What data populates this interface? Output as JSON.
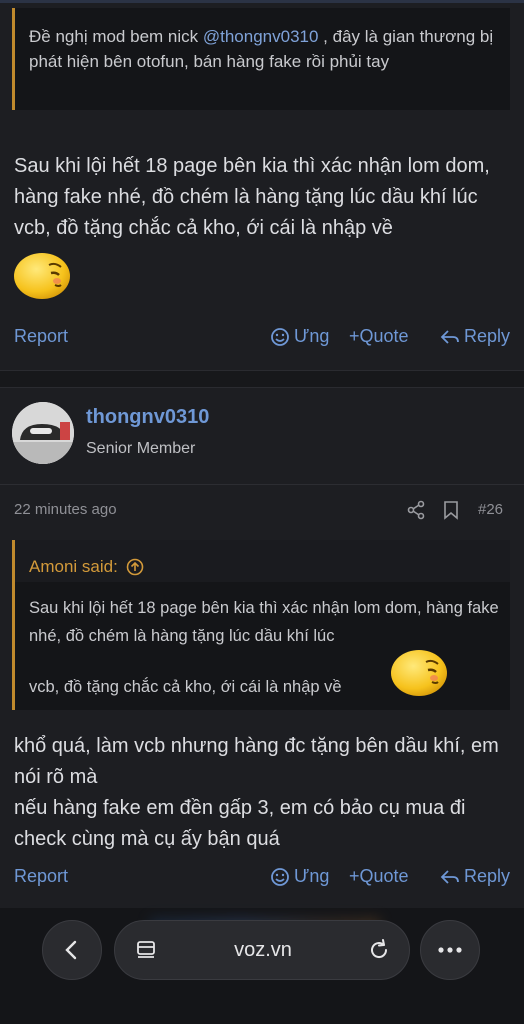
{
  "post1": {
    "quote_text_before": "Đề nghị mod bem nick ",
    "quote_mention": "@thongnv0310",
    "quote_text_after": " , đây là gian thương bị phát hiện bên otofun, bán hàng fake rồi phủi tay",
    "message": "Sau khi lội hết 18 page bên kia thì xác nhận lom dom, hàng fake nhé, đồ chém là hàng tặng lúc dầu khí lúc vcb, đồ tặng chắc cả kho, ới cái là nhập về",
    "actions": {
      "report": "Report",
      "react": "Ưng",
      "quote": "+Quote",
      "reply": "Reply"
    }
  },
  "post2": {
    "username": "thongnv0310",
    "user_title": "Senior Member",
    "time": "22 minutes ago",
    "post_number": "#26",
    "quote_author": "Amoni said:",
    "quote_body": "Sau khi lội hết 18 page bên kia thì xác nhận lom dom, hàng fake nhé, đồ chém là hàng tặng lúc dầu khí lúc",
    "quote_line3": "vcb, đồ tặng chắc cả kho, ới cái là nhập về",
    "message_line1": "khổ quá, làm vcb nhưng hàng đc tặng bên dầu khí, em nói rõ mà",
    "message_line2": "nếu hàng fake em đền gấp 3, em có bảo cụ mua đi check cùng mà cụ ấy bận quá",
    "actions": {
      "report": "Report",
      "react": "Ưng",
      "quote": "+Quote",
      "reply": "Reply"
    }
  },
  "browser": {
    "url": "voz.vn"
  },
  "colors": {
    "link": "#6f98d6",
    "quote_accent": "#c08a2d",
    "background": "#1d1e22"
  }
}
